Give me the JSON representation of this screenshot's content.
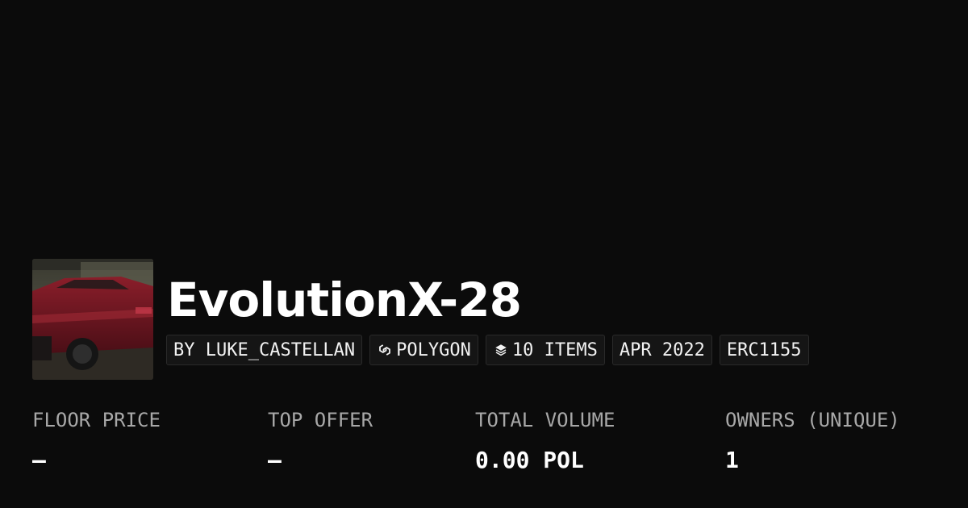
{
  "collection": {
    "title": "EvolutionX-28",
    "avatar_alt": "collection-avatar"
  },
  "chips": [
    {
      "label": "BY LUKE_CASTELLAN",
      "icon": ""
    },
    {
      "label": "POLYGON",
      "icon": "polygon-icon"
    },
    {
      "label": "10 ITEMS",
      "icon": "layers-icon"
    },
    {
      "label": "APR 2022",
      "icon": ""
    },
    {
      "label": "ERC1155",
      "icon": ""
    }
  ],
  "stats": {
    "floor_price": {
      "label": "FLOOR PRICE",
      "value": "–"
    },
    "top_offer": {
      "label": "TOP OFFER",
      "value": "–"
    },
    "total_volume": {
      "label": "TOTAL VOLUME",
      "value": "0.00 POL"
    },
    "owners": {
      "label": "OWNERS (UNIQUE)",
      "value": "1"
    }
  },
  "colors": {
    "background": "#0b0b0b",
    "chip_background": "#151515",
    "label_gray": "#a8a8a8"
  }
}
